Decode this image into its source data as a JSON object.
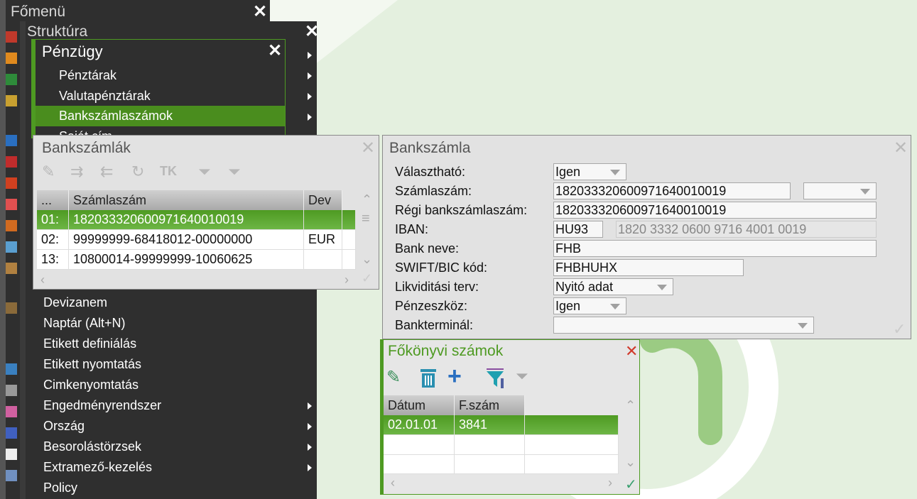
{
  "main_menu": {
    "title": "Főmenü"
  },
  "structure": {
    "title": "Struktúra",
    "items": [
      "Devizanem",
      "Naptár (Alt+N)",
      "Etikett definiálás",
      "Etikett nyomtatás",
      "Cimkenyomtatás",
      "Engedményrendszer",
      "Ország",
      "Besorolástörzsek",
      "Extramező-kezelés",
      "Policy"
    ]
  },
  "finance": {
    "title": "Pénzügy",
    "items": [
      "Pénztárak",
      "Valutapénztárak",
      "Bankszámlaszámok",
      "Saját cím"
    ],
    "selected": "Bankszámlaszámok"
  },
  "bank_accounts": {
    "title": "Bankszámlák",
    "columns": [
      "...",
      "Számlaszám",
      "Dev"
    ]
  },
  "bank_accounts_rows": [
    {
      "idx": "01:",
      "number": "182033320600971640010019",
      "dev": ""
    },
    {
      "idx": "02:",
      "number": "99999999-68418012-00000000",
      "dev": "EUR"
    },
    {
      "idx": "13:",
      "number": "10800014-99999999-10060625",
      "dev": ""
    }
  ],
  "bank_account": {
    "title": "Bankszámla",
    "labels": [
      "Választható:",
      "Számlaszám:",
      "Régi bankszámlaszám:",
      "IBAN:",
      "Bank neve:",
      "SWIFT/BIC kód:",
      "Likviditási terv:",
      "Pénzeszköz:",
      "Bankterminál:"
    ],
    "selectable": "Igen",
    "account_number": "182033320600971640010019",
    "old_account_number": "182033320600971640010019",
    "iban_prefix": "HU93",
    "iban_rest": "1820 3332 0600 9716 4001 0019",
    "bank_name": "FHB",
    "swift": "FHBHUHX",
    "liquidity_plan": "Nyitó adat",
    "cash_equivalent": "Igen",
    "bank_terminal": ""
  },
  "ledger": {
    "title": "Főkönyvi számok",
    "columns": [
      "Dátum",
      "F.szám"
    ],
    "rows": [
      {
        "date": "02.01.01",
        "number": "3841"
      }
    ]
  },
  "colors": {
    "accent": "#4e9a22",
    "menu_bg": "#2f2f2f"
  }
}
